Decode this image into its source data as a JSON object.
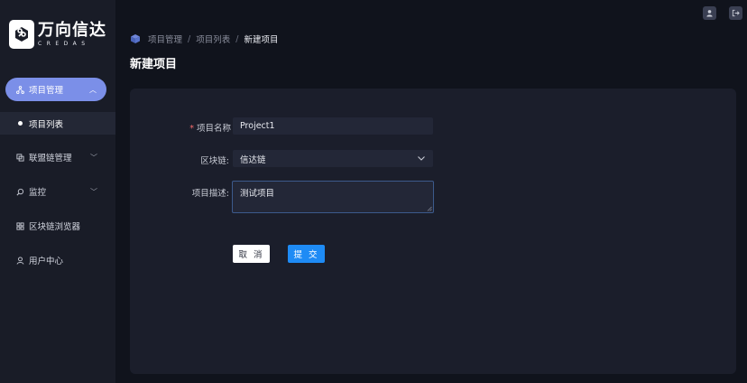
{
  "brand": {
    "name_cn": "万向信达",
    "name_en": "CREDAS"
  },
  "sidebar": {
    "items": [
      {
        "label": "项目管理",
        "icon": "network-icon",
        "active": true,
        "expandable": true,
        "expanded": true
      },
      {
        "label": "联盟链管理",
        "icon": "copy-icon",
        "expandable": true,
        "expanded": false
      },
      {
        "label": "监控",
        "icon": "monitor-search-icon",
        "expandable": true,
        "expanded": false
      },
      {
        "label": "区块链浏览器",
        "icon": "grid-icon",
        "expandable": false
      },
      {
        "label": "用户中心",
        "icon": "user-icon",
        "expandable": false
      }
    ],
    "sub_items": [
      {
        "label": "项目列表",
        "active": true
      }
    ]
  },
  "header": {
    "icons": [
      "user-icon",
      "logout-icon"
    ]
  },
  "breadcrumb": {
    "items": [
      "项目管理",
      "项目列表",
      "新建项目"
    ],
    "separator": "/"
  },
  "page": {
    "title": "新建项目"
  },
  "form": {
    "name": {
      "label": "项目名称",
      "value": "Project1",
      "required_mark": "*"
    },
    "chain": {
      "label": "区块链:",
      "value": "信达链"
    },
    "description": {
      "label": "项目描述:",
      "value": "测试项目"
    },
    "cancel_label": "取 消",
    "submit_label": "提 交"
  },
  "colors": {
    "sidebar_active": "#7b8fe8",
    "primary_button": "#1e8bf5",
    "required": "#f56c6c",
    "background": "#10131c"
  }
}
